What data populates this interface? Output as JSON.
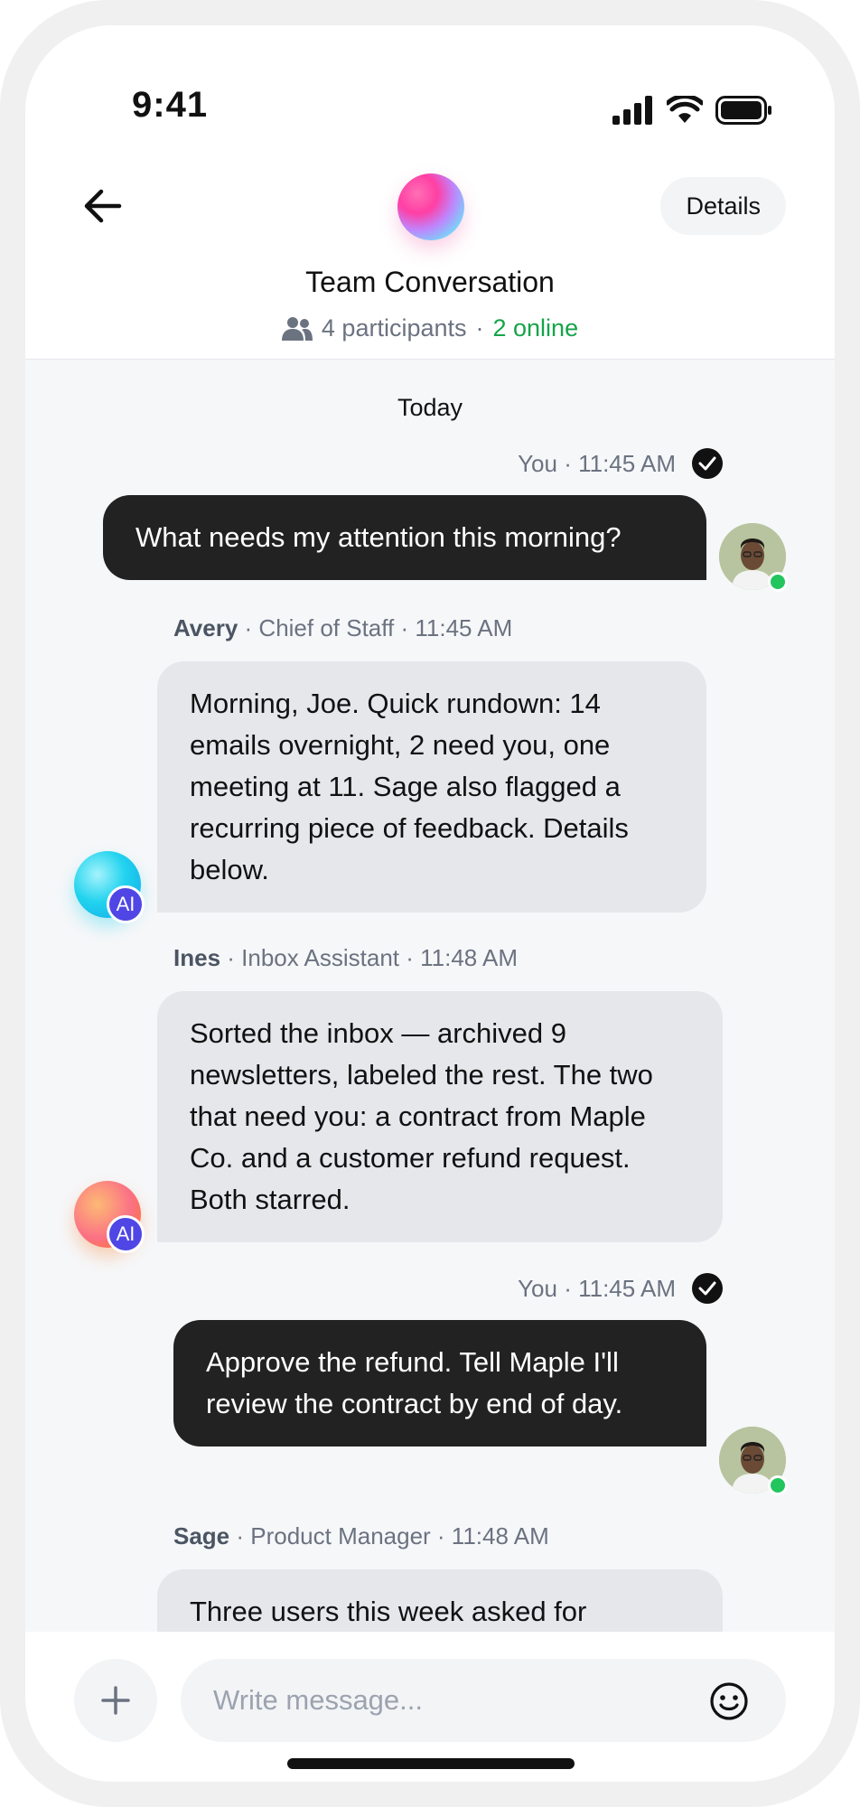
{
  "status_bar": {
    "time": "9:41"
  },
  "header": {
    "back_icon": "arrow-left-icon",
    "details_label": "Details",
    "title": "Team Conversation",
    "participants": "4 participants",
    "separator": "·",
    "online": "2 online"
  },
  "chat": {
    "day_label": "Today",
    "messages": [
      {
        "meta": "You · 11:45 AM",
        "text": "What needs my attention this morning?"
      },
      {
        "name": "Avery",
        "meta": " · Chief of Staff · 11:45 AM",
        "badge": "AI",
        "text": "Morning, Joe. Quick rundown: 14 emails overnight, 2 need you, one meeting at 11. Sage also flagged a recurring piece of feedback. Details below."
      },
      {
        "name": "Ines",
        "meta": " · Inbox Assistant · 11:48 AM",
        "badge": "AI",
        "text": "Sorted the inbox — archived 9 newsletters, labeled the rest. The two that need you: a contract from Maple Co. and a customer refund request. Both starred."
      },
      {
        "meta": "You · 11:45 AM",
        "text": "Approve the refund. Tell Maple I'll review the contract by end of day."
      },
      {
        "name": "Sage",
        "meta": " · Product Manager · 11:48 AM",
        "text": "Three users this week asked for"
      }
    ]
  },
  "composer": {
    "placeholder": "Write message...",
    "plus_icon": "plus-icon",
    "emoji_icon": "smiley-icon"
  },
  "colors": {
    "online_green": "#16a34a",
    "ai_badge": "#4f46e5",
    "outgoing_bubble": "#222222",
    "incoming_bubble": "#e5e7eb"
  }
}
